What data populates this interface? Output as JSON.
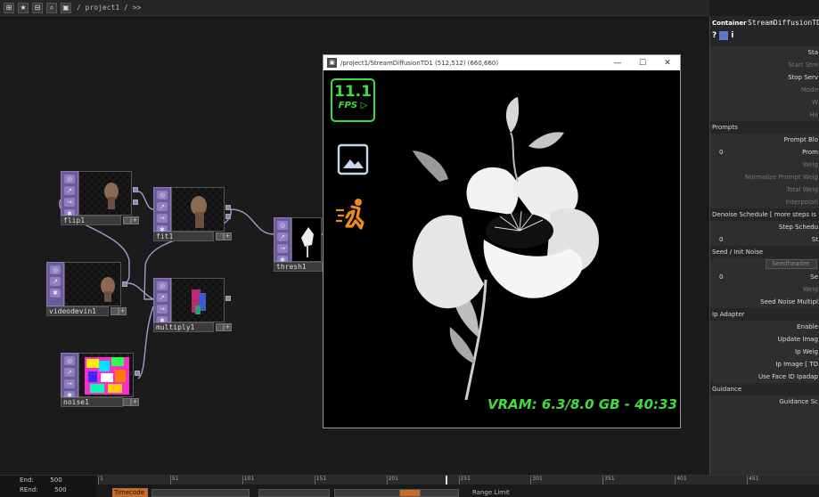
{
  "topbar": {
    "path": "/ project1 / >>",
    "buttons": [
      "⊞",
      "★",
      "⊟",
      "⌕",
      "▣"
    ]
  },
  "network": {
    "nodes": {
      "flip": "flip1",
      "fit": "fit1",
      "thresh": "thresh1",
      "videodevin": "videodevin1",
      "multiply": "multiply1",
      "noise": "noise1"
    }
  },
  "window": {
    "title": "/project1/StreamDiffusionTD1 (512,512) (660,660)",
    "icon": "window-app-icon",
    "controls": {
      "minimize": "—",
      "maximize": "☐",
      "close": "✕"
    },
    "fps_value": "11.1",
    "fps_label": "FPS ▷",
    "vram_text": "VRAM: 6.3/8.0 GB - 40:33",
    "accent_color": "#3fdc3f",
    "run_color": "#f08a1e"
  },
  "panel": {
    "type_label": "Container",
    "component_name": "StreamDiffusionTD",
    "help_icon": "?",
    "info_icon": "i",
    "rows": [
      {
        "kind": "label",
        "text": "Sta"
      },
      {
        "kind": "dim",
        "text": "Start Stre"
      },
      {
        "kind": "label",
        "text": "Stop Serv"
      },
      {
        "kind": "dim",
        "text": "Mode"
      },
      {
        "kind": "dim",
        "text": "W"
      },
      {
        "kind": "dim",
        "text": "He"
      },
      {
        "kind": "section",
        "text": "Prompts"
      },
      {
        "kind": "label",
        "text": "Prompt Blo"
      },
      {
        "kind": "value",
        "value": "0",
        "text": "Prom"
      },
      {
        "kind": "dim",
        "text": "Weig"
      },
      {
        "kind": "dim",
        "text": "Normalize Prompt Weig"
      },
      {
        "kind": "dim",
        "text": "Total Weig"
      },
      {
        "kind": "dim",
        "text": "Interpolati"
      },
      {
        "kind": "section",
        "text": "Denoise Schedule [ more steps is"
      },
      {
        "kind": "label",
        "text": "Step Schedu"
      },
      {
        "kind": "value",
        "value": "0",
        "text": "St"
      },
      {
        "kind": "section",
        "text": "Seed / Init Noise"
      },
      {
        "kind": "field",
        "text": "Seedheader"
      },
      {
        "kind": "value",
        "value": "0",
        "text": "Se"
      },
      {
        "kind": "dim",
        "text": "Weig"
      },
      {
        "kind": "label",
        "text": "Seed Noise Multipl"
      },
      {
        "kind": "section",
        "text": "Ip Adapter"
      },
      {
        "kind": "label",
        "text": "Enable"
      },
      {
        "kind": "label",
        "text": "Update Imag"
      },
      {
        "kind": "label",
        "text": "Ip Weig"
      },
      {
        "kind": "label",
        "text": "Ip Image [ TO"
      },
      {
        "kind": "label",
        "text": "Use Face ID Ipadap"
      },
      {
        "kind": "section",
        "text": "Guidance"
      },
      {
        "kind": "label",
        "text": "Guidance Sc"
      }
    ]
  },
  "timeline": {
    "end_label": "End:",
    "end_value": "500",
    "rend_label": "REnd:",
    "rend_value": "500",
    "ticks": [
      "1",
      "51",
      "101",
      "151",
      "201",
      "251",
      "301",
      "351",
      "401",
      "451"
    ],
    "timecode_label": "Timecode",
    "range_label": "Range Limit"
  }
}
